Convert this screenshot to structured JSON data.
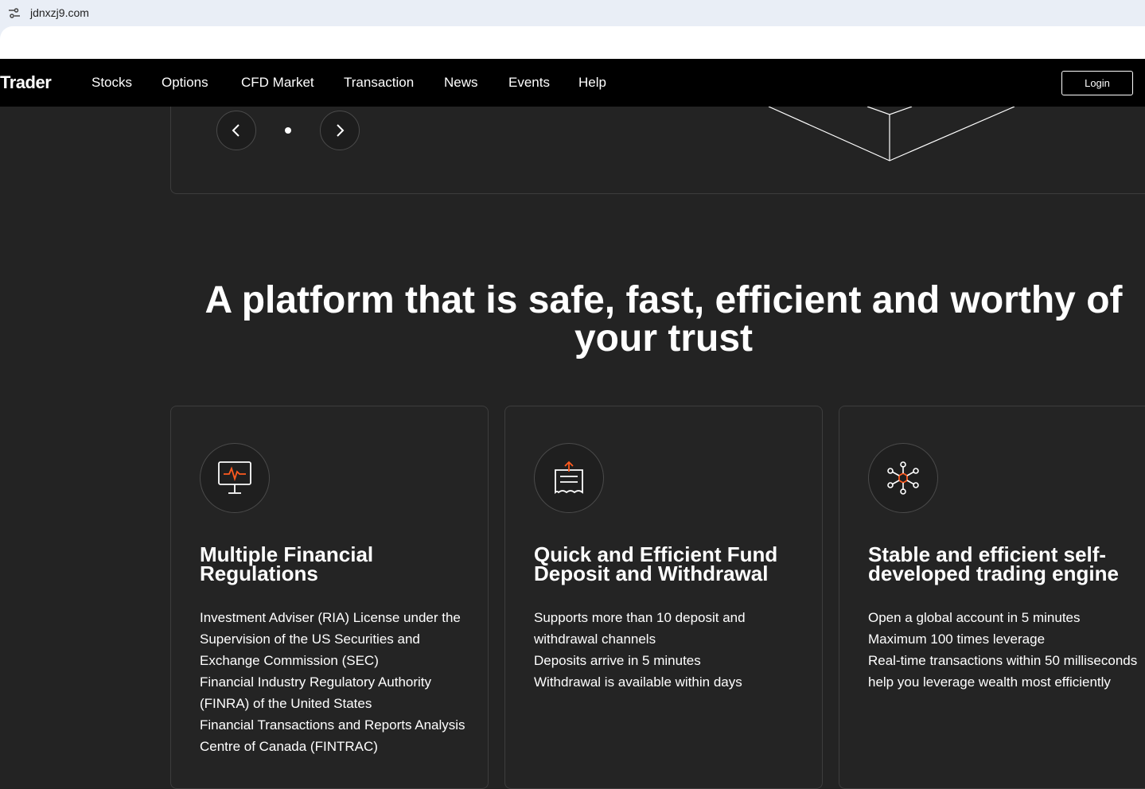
{
  "browser": {
    "url": "jdnxzj9.com",
    "site_icon": "site-settings-icon"
  },
  "nav": {
    "brand": "Trader",
    "items": [
      {
        "label": "Stocks"
      },
      {
        "label": "Options"
      },
      {
        "label": "CFD Market"
      },
      {
        "label": "Transaction"
      },
      {
        "label": "News"
      },
      {
        "label": "Events"
      },
      {
        "label": "Help"
      }
    ],
    "login_label": "Login"
  },
  "carousel": {
    "prev_icon": "chevron-left-icon",
    "next_icon": "chevron-right-icon"
  },
  "headline": "A platform that is safe, fast, efficient and worthy of your trust",
  "colors": {
    "accent": "#ff5a1f",
    "background": "#232323",
    "nav_background": "#000000"
  },
  "features": [
    {
      "icon": "monitor-pulse-icon",
      "title": "Multiple Financial Regulations",
      "lines": [
        "Investment Adviser (RIA) License under the Supervision of the US Securities and Exchange Commission (SEC)",
        "Financial Industry Regulatory Authority (FINRA) of the United States",
        "Financial Transactions and Reports Analysis Centre of Canada (FINTRAC)"
      ]
    },
    {
      "icon": "clipboard-upload-icon",
      "title": "Quick and Efficient Fund Deposit and Withdrawal",
      "lines": [
        "Supports more than 10 deposit and withdrawal channels",
        "Deposits arrive in 5 minutes",
        "Withdrawal is available within days"
      ]
    },
    {
      "icon": "network-hub-icon",
      "title": "Stable and efficient self-developed trading engine",
      "lines": [
        "Open a global account in 5 minutes",
        "Maximum 100 times leverage",
        "Real-time transactions within 50 milliseconds help you leverage wealth most efficiently"
      ]
    }
  ]
}
